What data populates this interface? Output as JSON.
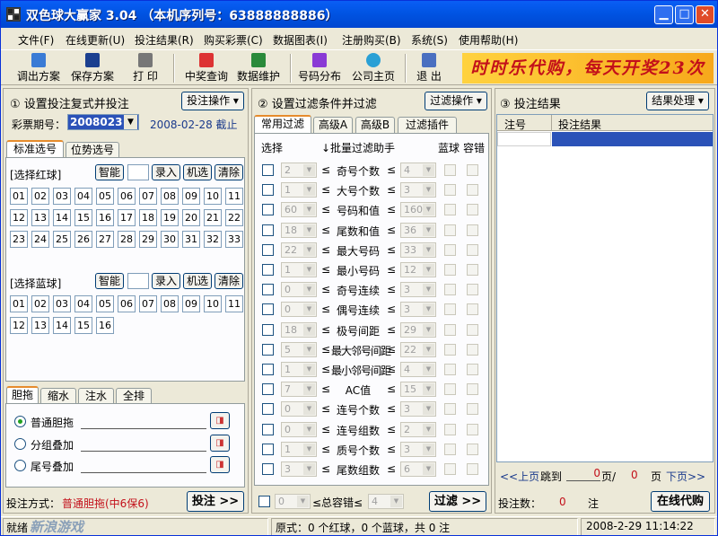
{
  "title": "双色球大赢家 3.04 （本机序列号：63888888886）",
  "menu": [
    "文件(F)",
    "在线更新(U)",
    "投注结果(R)",
    "购买彩票(C)",
    "数据图表(I)",
    "注册购买(B)",
    "系统(S)",
    "使用帮助(H)"
  ],
  "toolbar": {
    "export": "调出方案",
    "save": "保存方案",
    "print": "打 印",
    "prize": "中奖查询",
    "maint": "数据维护",
    "dist": "号码分布",
    "home": "公司主页",
    "exit": "退 出"
  },
  "banner": "时时乐代购，每天开奖23次",
  "colors": {
    "title_bar": "#0054e3",
    "banner_text": "#c3101a",
    "banner_bg": "#ffd23f",
    "highlight": "#2b52b8"
  },
  "left": {
    "title": "① 设置投注复式并投注",
    "op_btn": "投注操作",
    "period_label": "彩票期号：",
    "period_value": "2008023",
    "deadline": "2008-02-28 截止",
    "tabs": [
      "标准选号",
      "位势选号"
    ],
    "red_label": "[选择红球]",
    "blue_label": "[选择蓝球]",
    "smart": "智能",
    "enter": "录入",
    "random": "机选",
    "clear": "清除",
    "red": [
      "01",
      "02",
      "03",
      "04",
      "05",
      "06",
      "07",
      "08",
      "09",
      "10",
      "11",
      "12",
      "13",
      "14",
      "15",
      "16",
      "17",
      "18",
      "19",
      "20",
      "21",
      "22",
      "23",
      "24",
      "25",
      "26",
      "27",
      "28",
      "29",
      "30",
      "31",
      "32",
      "33"
    ],
    "blue": [
      "01",
      "02",
      "03",
      "04",
      "05",
      "06",
      "07",
      "08",
      "09",
      "10",
      "11",
      "12",
      "13",
      "14",
      "15",
      "16"
    ],
    "btabs": [
      "胆拖",
      "缩水",
      "注水",
      "全排"
    ],
    "radios": [
      "普通胆拖",
      "分组叠加",
      "尾号叠加"
    ],
    "mode_label": "投注方式：",
    "mode_value": "普通胆拖(中6保6)",
    "bet_btn": "投注 >>"
  },
  "mid": {
    "title": "② 设置过滤条件并过滤",
    "op_btn": "过滤操作",
    "tabs": [
      "常用过滤",
      "高级A",
      "高级B",
      "过滤插件"
    ],
    "h_select": "选择",
    "h_helper": "↓批量过滤助手",
    "h_blue": "蓝球",
    "h_tol": "容错",
    "rows": [
      {
        "min": "2",
        "name": "奇号个数",
        "max": "4"
      },
      {
        "min": "1",
        "name": "大号个数",
        "max": "3"
      },
      {
        "min": "60",
        "name": "号码和值",
        "max": "160"
      },
      {
        "min": "18",
        "name": "尾数和值",
        "max": "36"
      },
      {
        "min": "22",
        "name": "最大号码",
        "max": "33"
      },
      {
        "min": "1",
        "name": "最小号码",
        "max": "12"
      },
      {
        "min": "0",
        "name": "奇号连续",
        "max": "3"
      },
      {
        "min": "0",
        "name": "偶号连续",
        "max": "3"
      },
      {
        "min": "18",
        "name": "极号间距",
        "max": "29"
      },
      {
        "min": "5",
        "name": "最大邻号间距",
        "max": "22"
      },
      {
        "min": "1",
        "name": "最小邻号间距",
        "max": "4"
      },
      {
        "min": "7",
        "name": "AC值",
        "max": "15"
      },
      {
        "min": "0",
        "name": "连号个数",
        "max": "3"
      },
      {
        "min": "0",
        "name": "连号组数",
        "max": "2"
      },
      {
        "min": "1",
        "name": "质号个数",
        "max": "3"
      },
      {
        "min": "3",
        "name": "尾数组数",
        "max": "6"
      }
    ],
    "lt": "≤",
    "tol_value": "0",
    "tol_label": "≤总容错≤",
    "tol_max": "4",
    "filter_btn": "过滤 >>"
  },
  "right": {
    "title": "③ 投注结果",
    "op_btn": "结果处理",
    "col_no": "注号",
    "col_res": "投注结果",
    "prev": "<<上页",
    "jump": "跳到",
    "page": "0",
    "page_unit": "页/",
    "total": "0",
    "page_unit2": "页",
    "next": "下页>>",
    "count_label": "投注数：",
    "count": "0",
    "count_unit": "注",
    "buy_btn": "在线代购"
  },
  "status": {
    "ready": "就绪",
    "summary": "原式：0 个红球，0 个蓝球，共 0 注",
    "time": "2008-2-29 11:14:22",
    "watermark": "新浪游戏"
  }
}
